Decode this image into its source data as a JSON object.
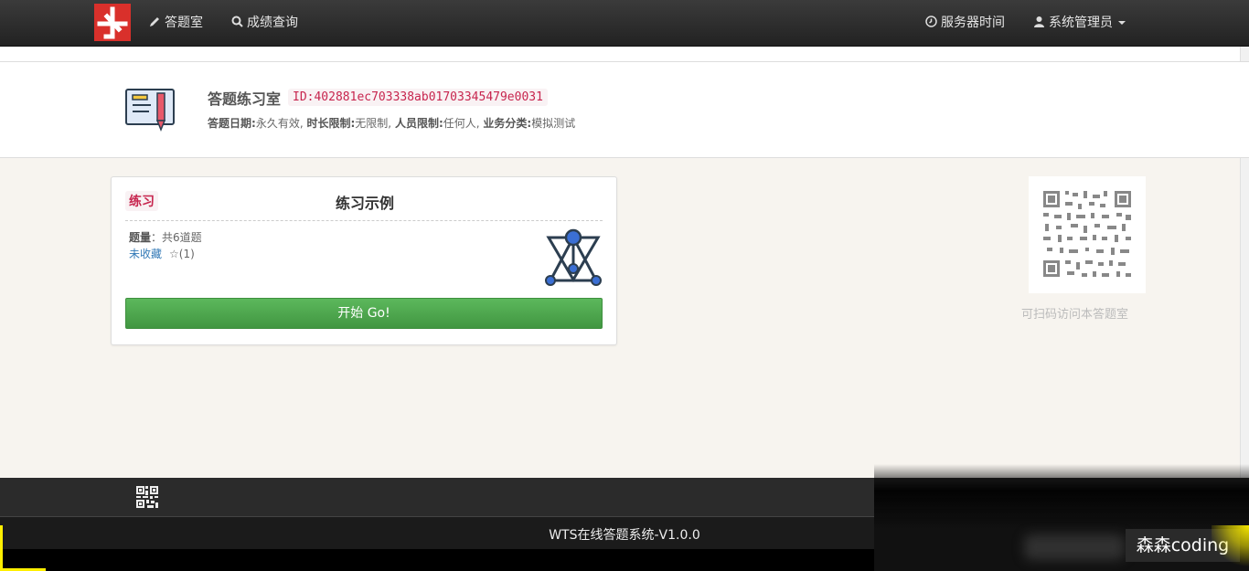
{
  "nav": {
    "exam_room": "答题室",
    "score_query": "成绩查询",
    "server_time": "服务器时间",
    "user": "系统管理员"
  },
  "room": {
    "title": "答题练习室",
    "id": "ID:402881ec703338ab01703345479e0031",
    "meta": {
      "date_label": "答题日期:",
      "date_value": "永久有效,",
      "time_label": "时长限制:",
      "time_value": "无限制,",
      "people_label": "人员限制:",
      "people_value": "任何人,",
      "category_label": "业务分类:",
      "category_value": "模拟测试"
    }
  },
  "card": {
    "tag": "练习",
    "title": "练习示例",
    "count_label": "题量",
    "count_value": "：共6道题",
    "fav_label": "未收藏",
    "fav_stars": "☆(1)",
    "start_button": "开始 Go!"
  },
  "qr": {
    "caption": "可扫码访问本答题室"
  },
  "footer": {
    "text": "WTS在线答题系统-V1.0.0"
  },
  "watermark": "森森coding",
  "colors": {
    "brand_red": "#d9302b",
    "accent_green": "#4cae4c",
    "tag_pink": "#c7254e",
    "nav_dark": "#2b2b2b"
  },
  "icons": {
    "exam_room": "pencil-icon",
    "score_query": "search-icon",
    "server_time": "clock-icon",
    "user": "user-icon"
  }
}
